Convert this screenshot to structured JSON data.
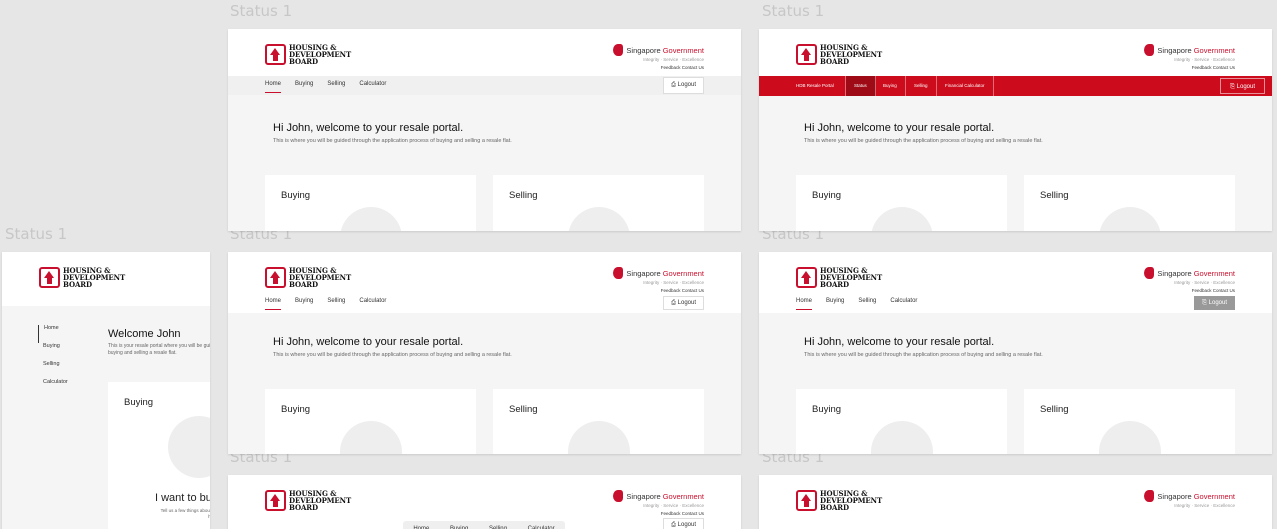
{
  "status_label": "Status 1",
  "brand": {
    "hdb_line1": "HOUSING &",
    "hdb_line2": "DEVELOPMENT",
    "hdb_line3": "BOARD",
    "sg_name_a": "Singapore",
    "sg_name_b": "Government",
    "sg_tagline": "Integrity · Service · Excellence",
    "sg_links": "Feedback   Contact Us"
  },
  "nav": {
    "home": "Home",
    "buying": "Buying",
    "selling": "Selling",
    "calculator": "Calculator",
    "logout": "Logout"
  },
  "red_nav": {
    "portal": "HDB Resale Portal",
    "status": "Status",
    "buying": "Buying",
    "selling": "Selling",
    "calculator": "Financial Calculator",
    "logout": "Logout"
  },
  "portal": {
    "greeting": "Hi John, welcome to your resale portal.",
    "subtext": "This is where you will be guided through the application process of buying and selling a resale flat."
  },
  "side_variant": {
    "welcome": "Welcome John",
    "subtext": "This is your resale portal where you will be guided through the application process of buying and selling a resale flat.",
    "cta": "I want to buy",
    "cta_sub": "Tell us a few things about your application so we can help."
  },
  "cards": {
    "buying": "Buying",
    "selling": "Selling"
  },
  "colors": {
    "brand_red": "#c8102e",
    "nav_red": "#cc0b1c",
    "canvas": "#e6e6e6",
    "panel": "#f5f5f5"
  }
}
